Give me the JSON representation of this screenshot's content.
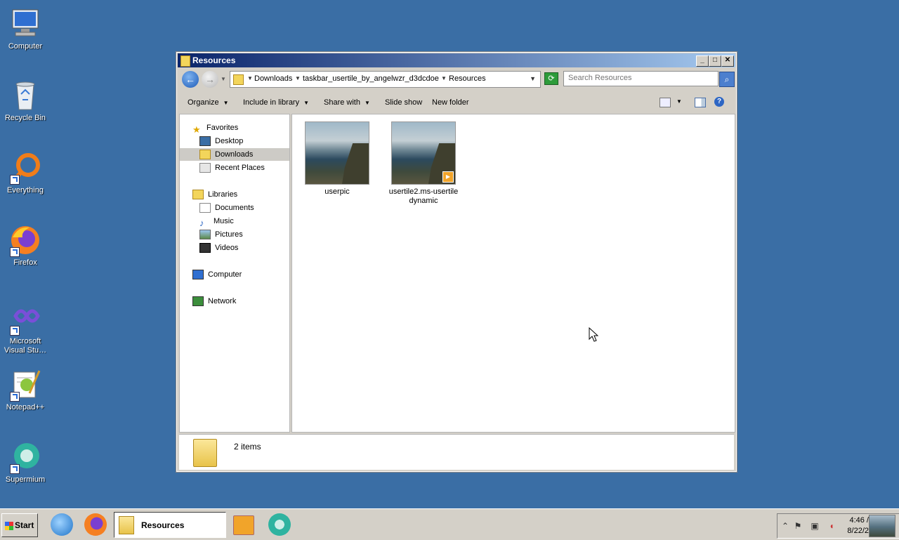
{
  "desktop": {
    "icons": [
      {
        "label": "Computer",
        "icon": "computer-icon"
      },
      {
        "label": "Recycle Bin",
        "icon": "recycle-bin-icon"
      },
      {
        "label": "Everything",
        "icon": "everything-icon"
      },
      {
        "label": "Firefox",
        "icon": "firefox-icon"
      },
      {
        "label": "Microsoft Visual Stu…",
        "icon": "visual-studio-icon"
      },
      {
        "label": "Notepad++",
        "icon": "notepadpp-icon"
      },
      {
        "label": "Supermium",
        "icon": "supermium-icon"
      }
    ]
  },
  "window": {
    "title": "Resources",
    "controls": {
      "minimize": "_",
      "maximize": "□",
      "close": "✕"
    },
    "address": {
      "crumbs": [
        "Downloads",
        "taskbar_usertile_by_angelwzr_d3dcdoe",
        "Resources"
      ]
    },
    "search": {
      "placeholder": "Search Resources"
    },
    "toolbar": {
      "organize": "Organize",
      "include": "Include in library",
      "share": "Share with",
      "slideshow": "Slide show",
      "newfolder": "New folder"
    },
    "nav": {
      "favorites": "Favorites",
      "desktop": "Desktop",
      "downloads": "Downloads",
      "recent": "Recent Places",
      "libraries": "Libraries",
      "documents": "Documents",
      "music": "Music",
      "pictures": "Pictures",
      "videos": "Videos",
      "computer": "Computer",
      "network": "Network"
    },
    "files": [
      {
        "name": "userpic"
      },
      {
        "name": "usertile2.ms-usertiledynamic"
      }
    ],
    "details": {
      "count": "2 items"
    }
  },
  "taskbar": {
    "start": "Start",
    "active_task": "Resources",
    "clock": {
      "time": "4:46 /",
      "date": "8/22/2"
    }
  },
  "colors": {
    "desktop": "#3a6ea5",
    "titlebar_start": "#0a246a",
    "titlebar_end": "#a6caf0"
  }
}
